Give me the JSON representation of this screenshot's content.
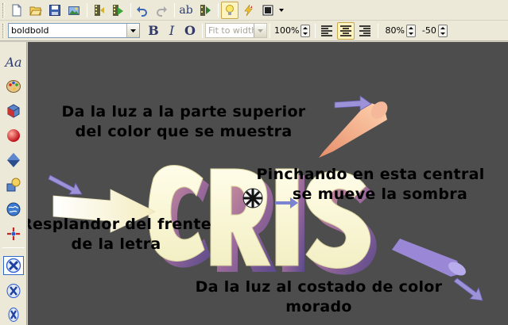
{
  "toolbar_main": {
    "buttons": [
      {
        "name": "new-document",
        "icon": "new-document-icon"
      },
      {
        "name": "open-folder",
        "icon": "open-folder-icon"
      },
      {
        "name": "save",
        "icon": "save-disk-icon"
      },
      {
        "name": "export-image",
        "icon": "export-image-icon"
      },
      {
        "name": "film-clip",
        "icon": "film-clip-icon"
      },
      {
        "name": "film-play",
        "icon": "film-play-icon"
      },
      {
        "name": "undo",
        "icon": "undo-icon"
      },
      {
        "name": "redo",
        "icon": "redo-icon"
      },
      {
        "name": "spell-check",
        "icon": "spell-check-icon",
        "label": "ab"
      },
      {
        "name": "preview-play",
        "icon": "preview-play-icon"
      },
      {
        "name": "light",
        "icon": "light-bulb-icon"
      },
      {
        "name": "lighting-effect",
        "icon": "lightning-icon"
      },
      {
        "name": "window-size",
        "icon": "window-icon"
      }
    ]
  },
  "toolbar_format": {
    "font_name": "boldbold",
    "bold_label": "B",
    "italic_label": "I",
    "outline_label": "O",
    "fit_mode": "Fit to width",
    "font_scale": "100%",
    "align": [
      "left",
      "center",
      "right"
    ],
    "align_selected": "center",
    "spacing": "80%",
    "offset": "-50"
  },
  "sidebar": {
    "tools": [
      {
        "name": "text",
        "icon": "text-aa-icon",
        "label": "Aa"
      },
      {
        "name": "color",
        "icon": "palette-icon"
      },
      {
        "name": "extrude",
        "icon": "3d-cube-icon"
      },
      {
        "name": "material",
        "icon": "sphere-icon"
      },
      {
        "name": "bevel",
        "icon": "diamond-icon"
      },
      {
        "name": "shapes",
        "icon": "shapes-icon"
      },
      {
        "name": "globe",
        "icon": "globe-icon"
      },
      {
        "name": "animate",
        "icon": "spinner-icon"
      },
      {
        "name": "rotate-x",
        "icon": "rotate-x-icon"
      },
      {
        "name": "rotate-x-2",
        "icon": "rotate-x-icon"
      },
      {
        "name": "rotate-x-3",
        "icon": "rotate-x-icon"
      }
    ],
    "selected": "rotate-x"
  },
  "canvas": {
    "background": "#4d4d4d",
    "title_text": "CRIS",
    "face_color": "#faf7d6",
    "side_color": "#9b6a9b",
    "annotations": {
      "top_light": [
        "Da la luz a la parte superior",
        "del color que se muestra"
      ],
      "center_shadow": [
        "Pinchando en esta central",
        "se mueve la sombra"
      ],
      "front_glow": [
        "Resplandor del frente",
        "de la letra"
      ],
      "side_light": [
        "Da la luz al costado de color",
        "morado"
      ]
    }
  }
}
